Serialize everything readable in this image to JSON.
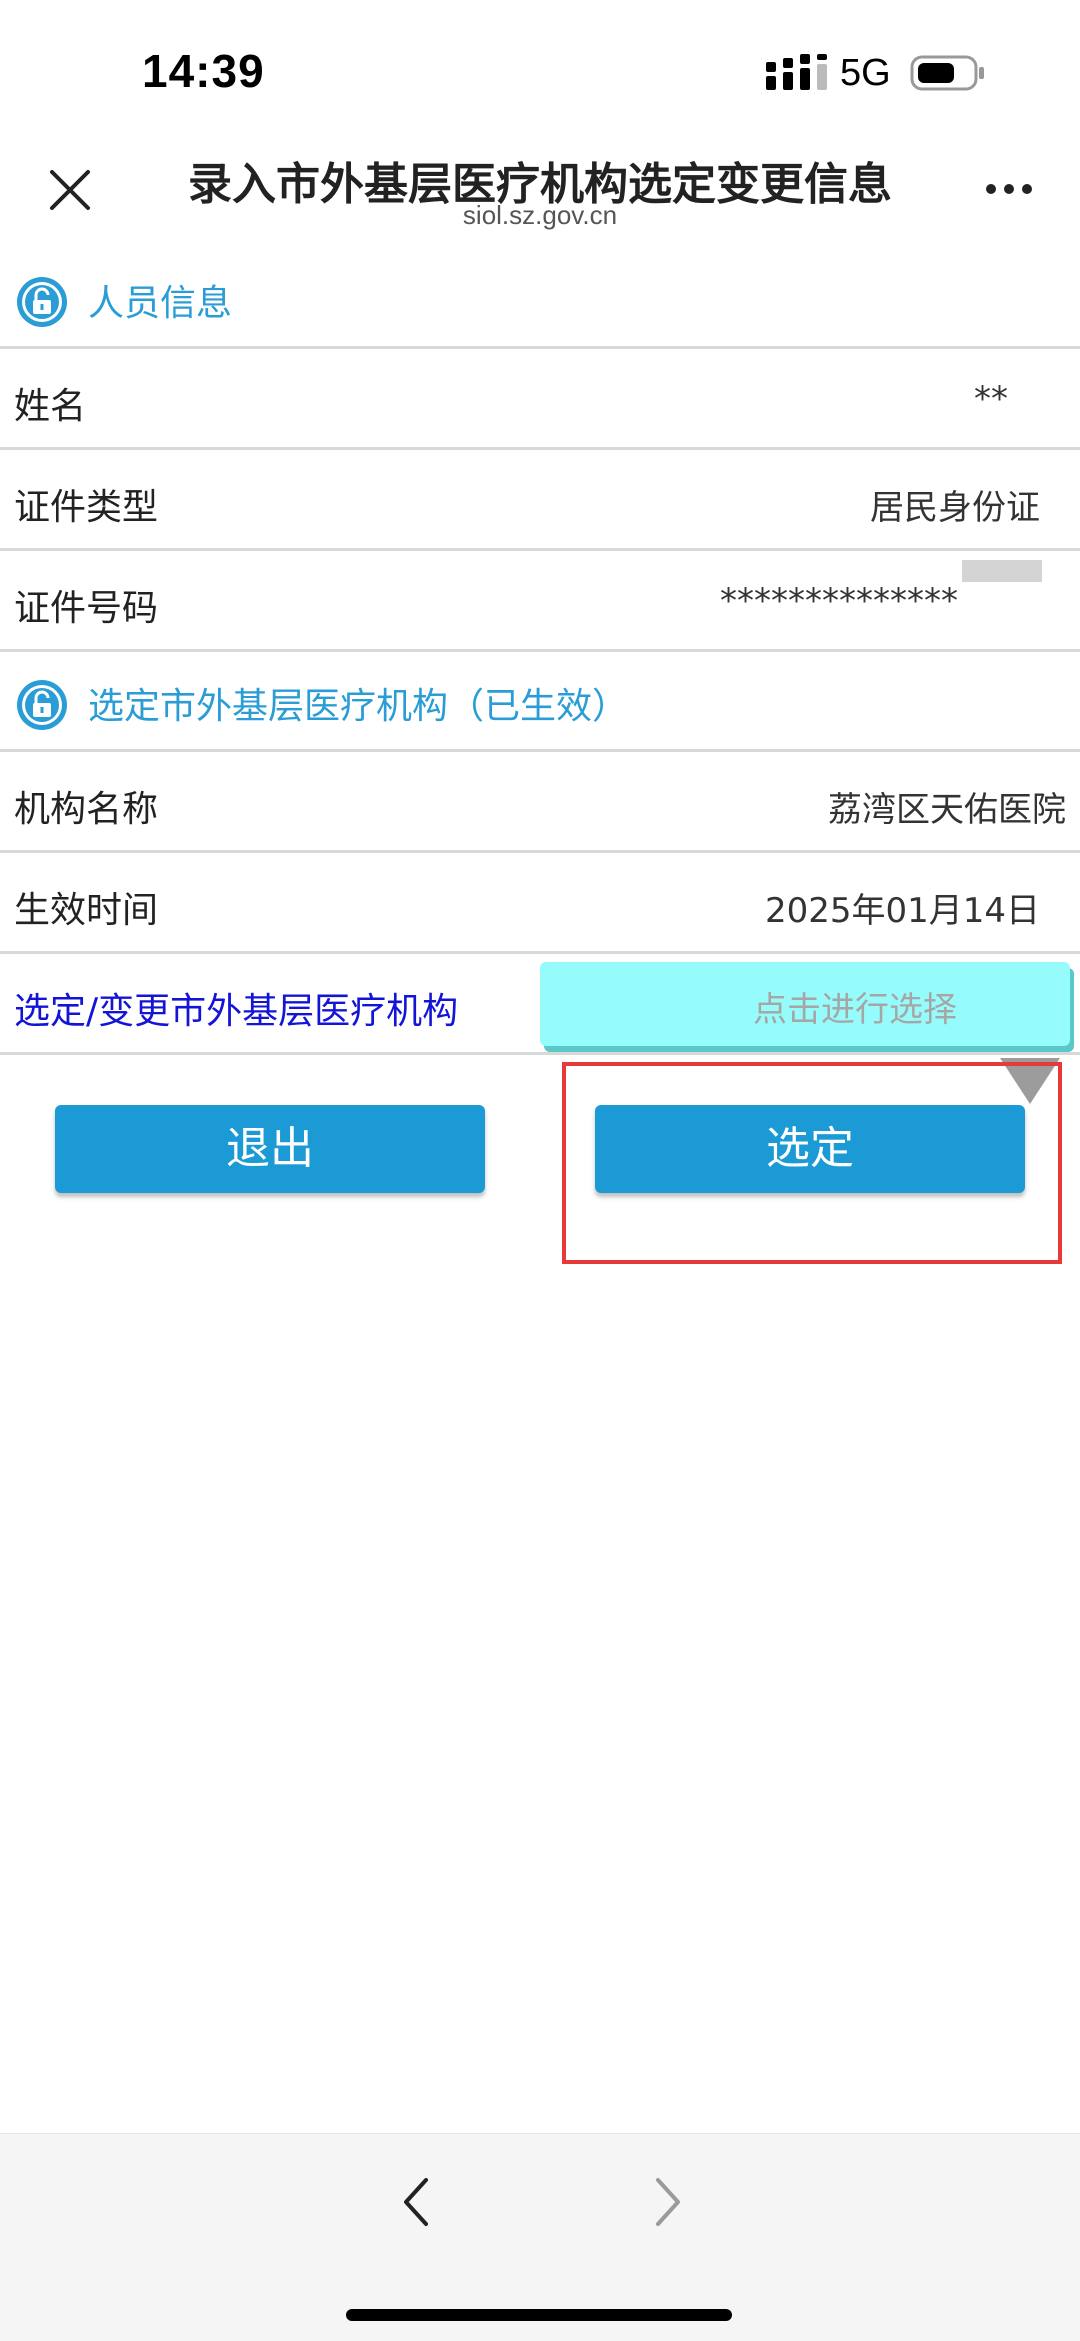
{
  "status_bar": {
    "time": "14:39",
    "network": "5G"
  },
  "header": {
    "title": "录入市外基层医疗机构选定变更信息",
    "subtitle": "siol.sz.gov.cn"
  },
  "section_personal": {
    "title": "人员信息",
    "rows": [
      {
        "label": "姓名",
        "value": "**"
      },
      {
        "label": "证件类型",
        "value": "居民身份证"
      },
      {
        "label": "证件号码",
        "value": "**************"
      }
    ]
  },
  "section_institution": {
    "title": "选定市外基层医疗机构（已生效）",
    "rows": [
      {
        "label": "机构名称",
        "value": "荔湾区天佑医院"
      },
      {
        "label": "生效时间",
        "value": "2025年01月14日"
      }
    ]
  },
  "select_row": {
    "label": "选定/变更市外基层医疗机构",
    "placeholder": "点击进行选择"
  },
  "buttons": {
    "exit": "退出",
    "confirm": "选定"
  },
  "colors": {
    "accent": "#1b9ad6",
    "section_title": "#2a9cd6",
    "select_label": "#1414d6",
    "highlight": "#e8393a"
  }
}
